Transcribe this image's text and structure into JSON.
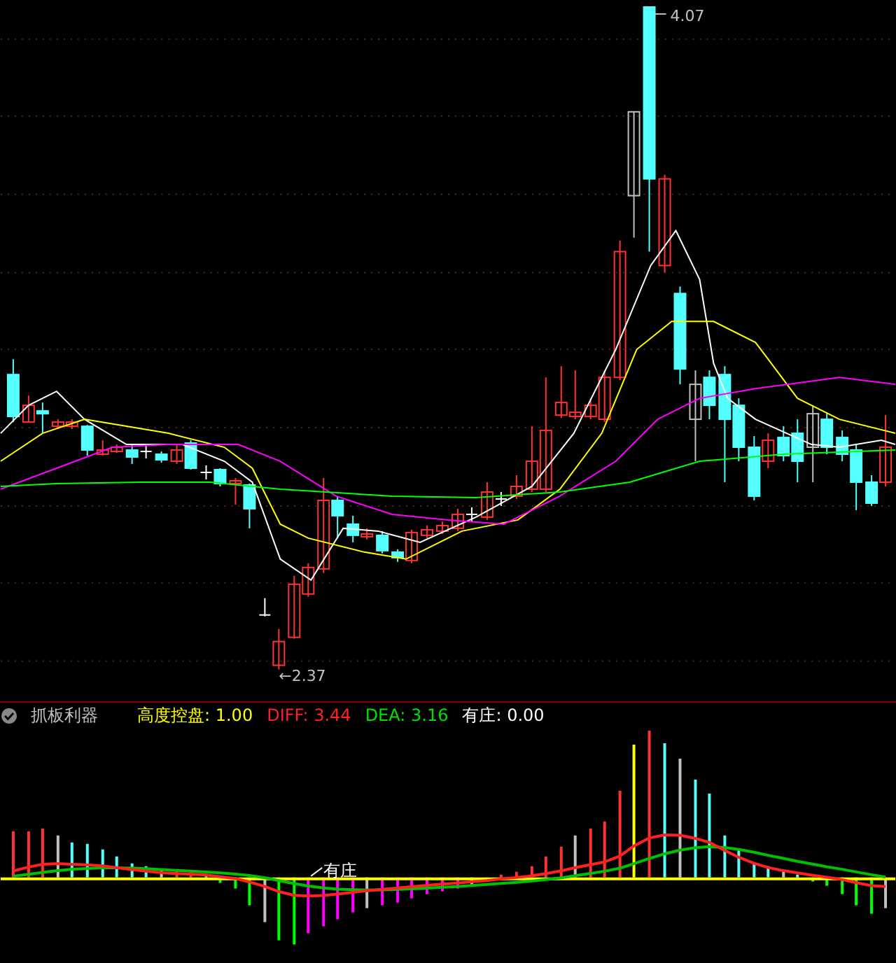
{
  "price_chart": {
    "high_label": "4.07",
    "low_label": "←2.37"
  },
  "indicator_panel": {
    "title": "抓板利器",
    "readings": [
      {
        "label": "高度控盘:",
        "value": "1.00",
        "color": "#ffff00"
      },
      {
        "label": "DIFF:",
        "value": "3.44",
        "color": "#ff2020"
      },
      {
        "label": "DEA:",
        "value": "3.16",
        "color": "#00e000"
      },
      {
        "label": "有庄:",
        "value": "0.00",
        "color": "#ffffff"
      }
    ]
  },
  "histogram_annotation": "有庄"
}
